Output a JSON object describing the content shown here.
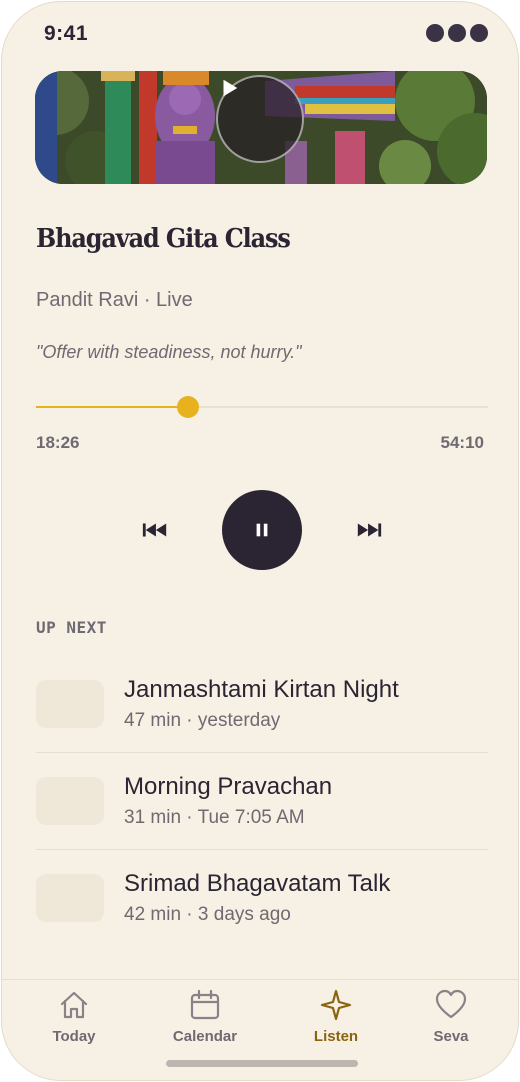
{
  "status_bar": {
    "time": "9:41"
  },
  "now_playing": {
    "title": "Bhagavad Gita Class",
    "subtitle": "Pandit Ravi · Live",
    "quote": "\"Offer with steadiness, not hurry.\"",
    "progress": 0.336,
    "elapsed": "18:26",
    "total": "54:10"
  },
  "queue": {
    "label": "UP NEXT",
    "items": [
      {
        "title": "Janmashtami Kirtan Night",
        "meta": "47 min · yesterday"
      },
      {
        "title": "Morning Pravachan",
        "meta": "31 min · Tue 7:05 AM"
      },
      {
        "title": "Srimad Bhagavatam Talk",
        "meta": "42 min · 3 days ago"
      }
    ]
  },
  "tabs": [
    {
      "label": "Today",
      "icon": "home-icon"
    },
    {
      "label": "Calendar",
      "icon": "calendar-icon"
    },
    {
      "label": "Listen",
      "icon": "sparkle-icon",
      "active": true
    },
    {
      "label": "Seva",
      "icon": "heart-icon"
    }
  ],
  "colors": {
    "background": "#f7f0e4",
    "accent": "#e8b21c",
    "active_tab": "#8a6410",
    "ink": "#2b2433"
  }
}
